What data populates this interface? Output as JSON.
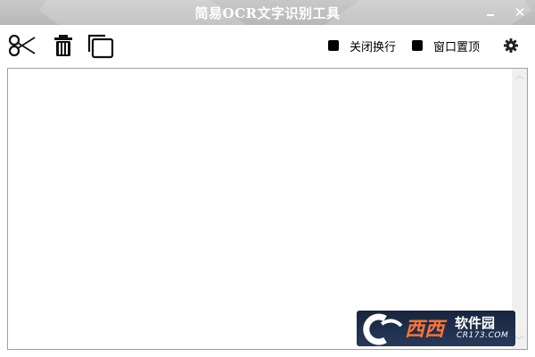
{
  "window": {
    "title": "简易OCR文字识别工具"
  },
  "toolbar": {
    "options": [
      {
        "label": "关闭换行",
        "checked": true
      },
      {
        "label": "窗口置顶",
        "checked": true
      }
    ]
  },
  "editor": {
    "value": ""
  },
  "watermark": {
    "brand": "西西",
    "name": "软件园",
    "url": "CR173.COM"
  },
  "icons": [
    "scissors-icon",
    "trash-icon",
    "copy-icon",
    "gear-icon",
    "minimize-icon",
    "close-icon"
  ],
  "colors": {
    "titlebar": "#bdbdbd",
    "watermark_bg": "#0b1a33",
    "watermark_brand": "#ff6d2a"
  }
}
